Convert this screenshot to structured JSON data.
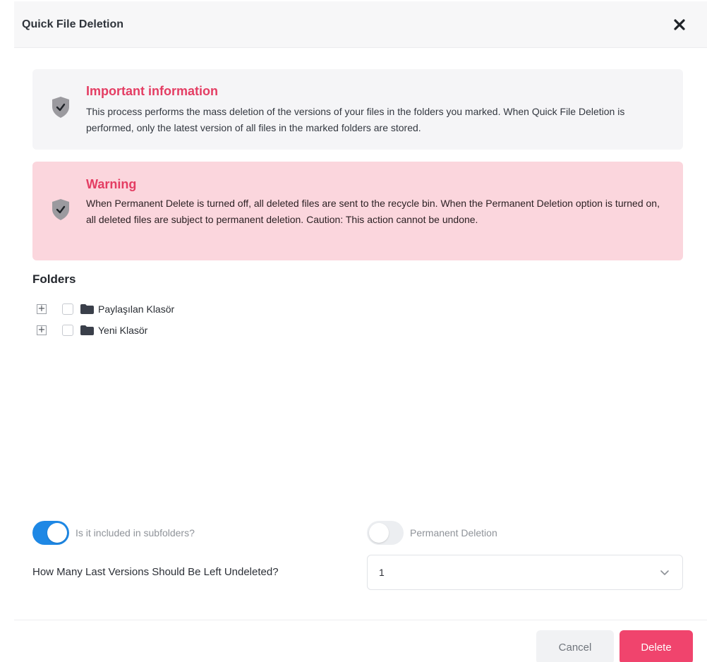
{
  "header": {
    "title": "Quick File Deletion",
    "close_icon": "close-icon"
  },
  "info": {
    "icon": "shield-check-icon",
    "title": "Important information",
    "text": "This process performs the mass deletion of the versions of your files in the folders you marked. When Quick File Deletion is performed, only the latest version of all files in the marked folders are stored."
  },
  "warning": {
    "icon": "shield-check-icon",
    "title": "Warning",
    "text": "When Permanent Delete is turned off, all deleted files are sent to the recycle bin. When the Permanent Deletion option is turned on, all deleted files are subject to permanent deletion. Caution: This action cannot be undone."
  },
  "folders": {
    "title": "Folders",
    "items": [
      {
        "label": "Paylaşılan Klasör",
        "expander": "+",
        "checked": false
      },
      {
        "label": "Yeni Klasör",
        "expander": "+",
        "checked": false
      }
    ]
  },
  "options": {
    "subfolders_label": "Is it included in subfolders?",
    "subfolders_on": true,
    "permanent_label": "Permanent Deletion",
    "permanent_on": false,
    "versions_label": "How Many Last Versions Should Be Left Undeleted?",
    "versions_value": "1"
  },
  "footer": {
    "cancel_label": "Cancel",
    "delete_label": "Delete"
  },
  "colors": {
    "accent_pink": "#e43d63",
    "delete_button": "#f0446d",
    "warning_bg": "#fbd6dd",
    "toggle_on": "#1e88e5"
  }
}
